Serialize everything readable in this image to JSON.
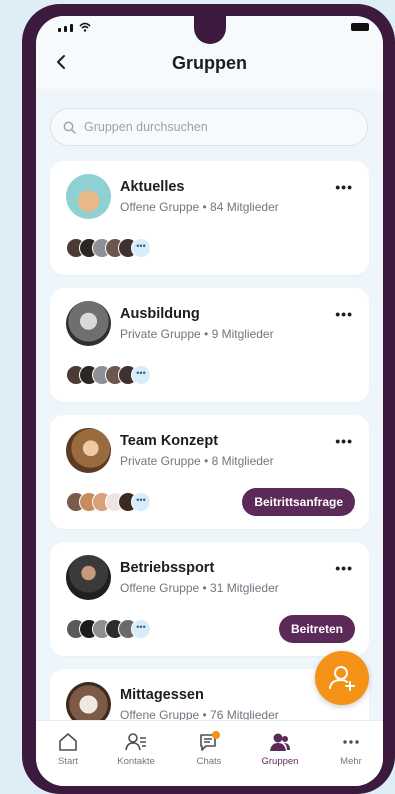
{
  "header": {
    "title": "Gruppen"
  },
  "search": {
    "placeholder": "Gruppen durchsuchen"
  },
  "groups": [
    {
      "name": "Aktuelles",
      "meta": "Offene Gruppe • 84 Mitglieder",
      "action": ""
    },
    {
      "name": "Ausbildung",
      "meta": "Private Gruppe • 9 Mitglieder",
      "action": ""
    },
    {
      "name": "Team Konzept",
      "meta": "Private Gruppe • 8 Mitglieder",
      "action": "Beitrittsanfrage"
    },
    {
      "name": "Betriebssport",
      "meta": "Offene Gruppe • 31 Mitglieder",
      "action": "Beitreten"
    },
    {
      "name": "Mittagessen",
      "meta": "Offene Gruppe • 76 Mitglieder",
      "action": ""
    }
  ],
  "more_label": "•••",
  "member_more": "•••",
  "tabs": [
    {
      "label": "Start",
      "icon": "home-icon"
    },
    {
      "label": "Kontakte",
      "icon": "contacts-icon"
    },
    {
      "label": "Chats",
      "icon": "chat-icon"
    },
    {
      "label": "Gruppen",
      "icon": "groups-icon"
    },
    {
      "label": "Mehr",
      "icon": "more-icon"
    }
  ],
  "active_tab": "Gruppen",
  "colors": {
    "accent": "#5b2a59",
    "fab": "#f39217",
    "frame": "#3b1a3d"
  }
}
